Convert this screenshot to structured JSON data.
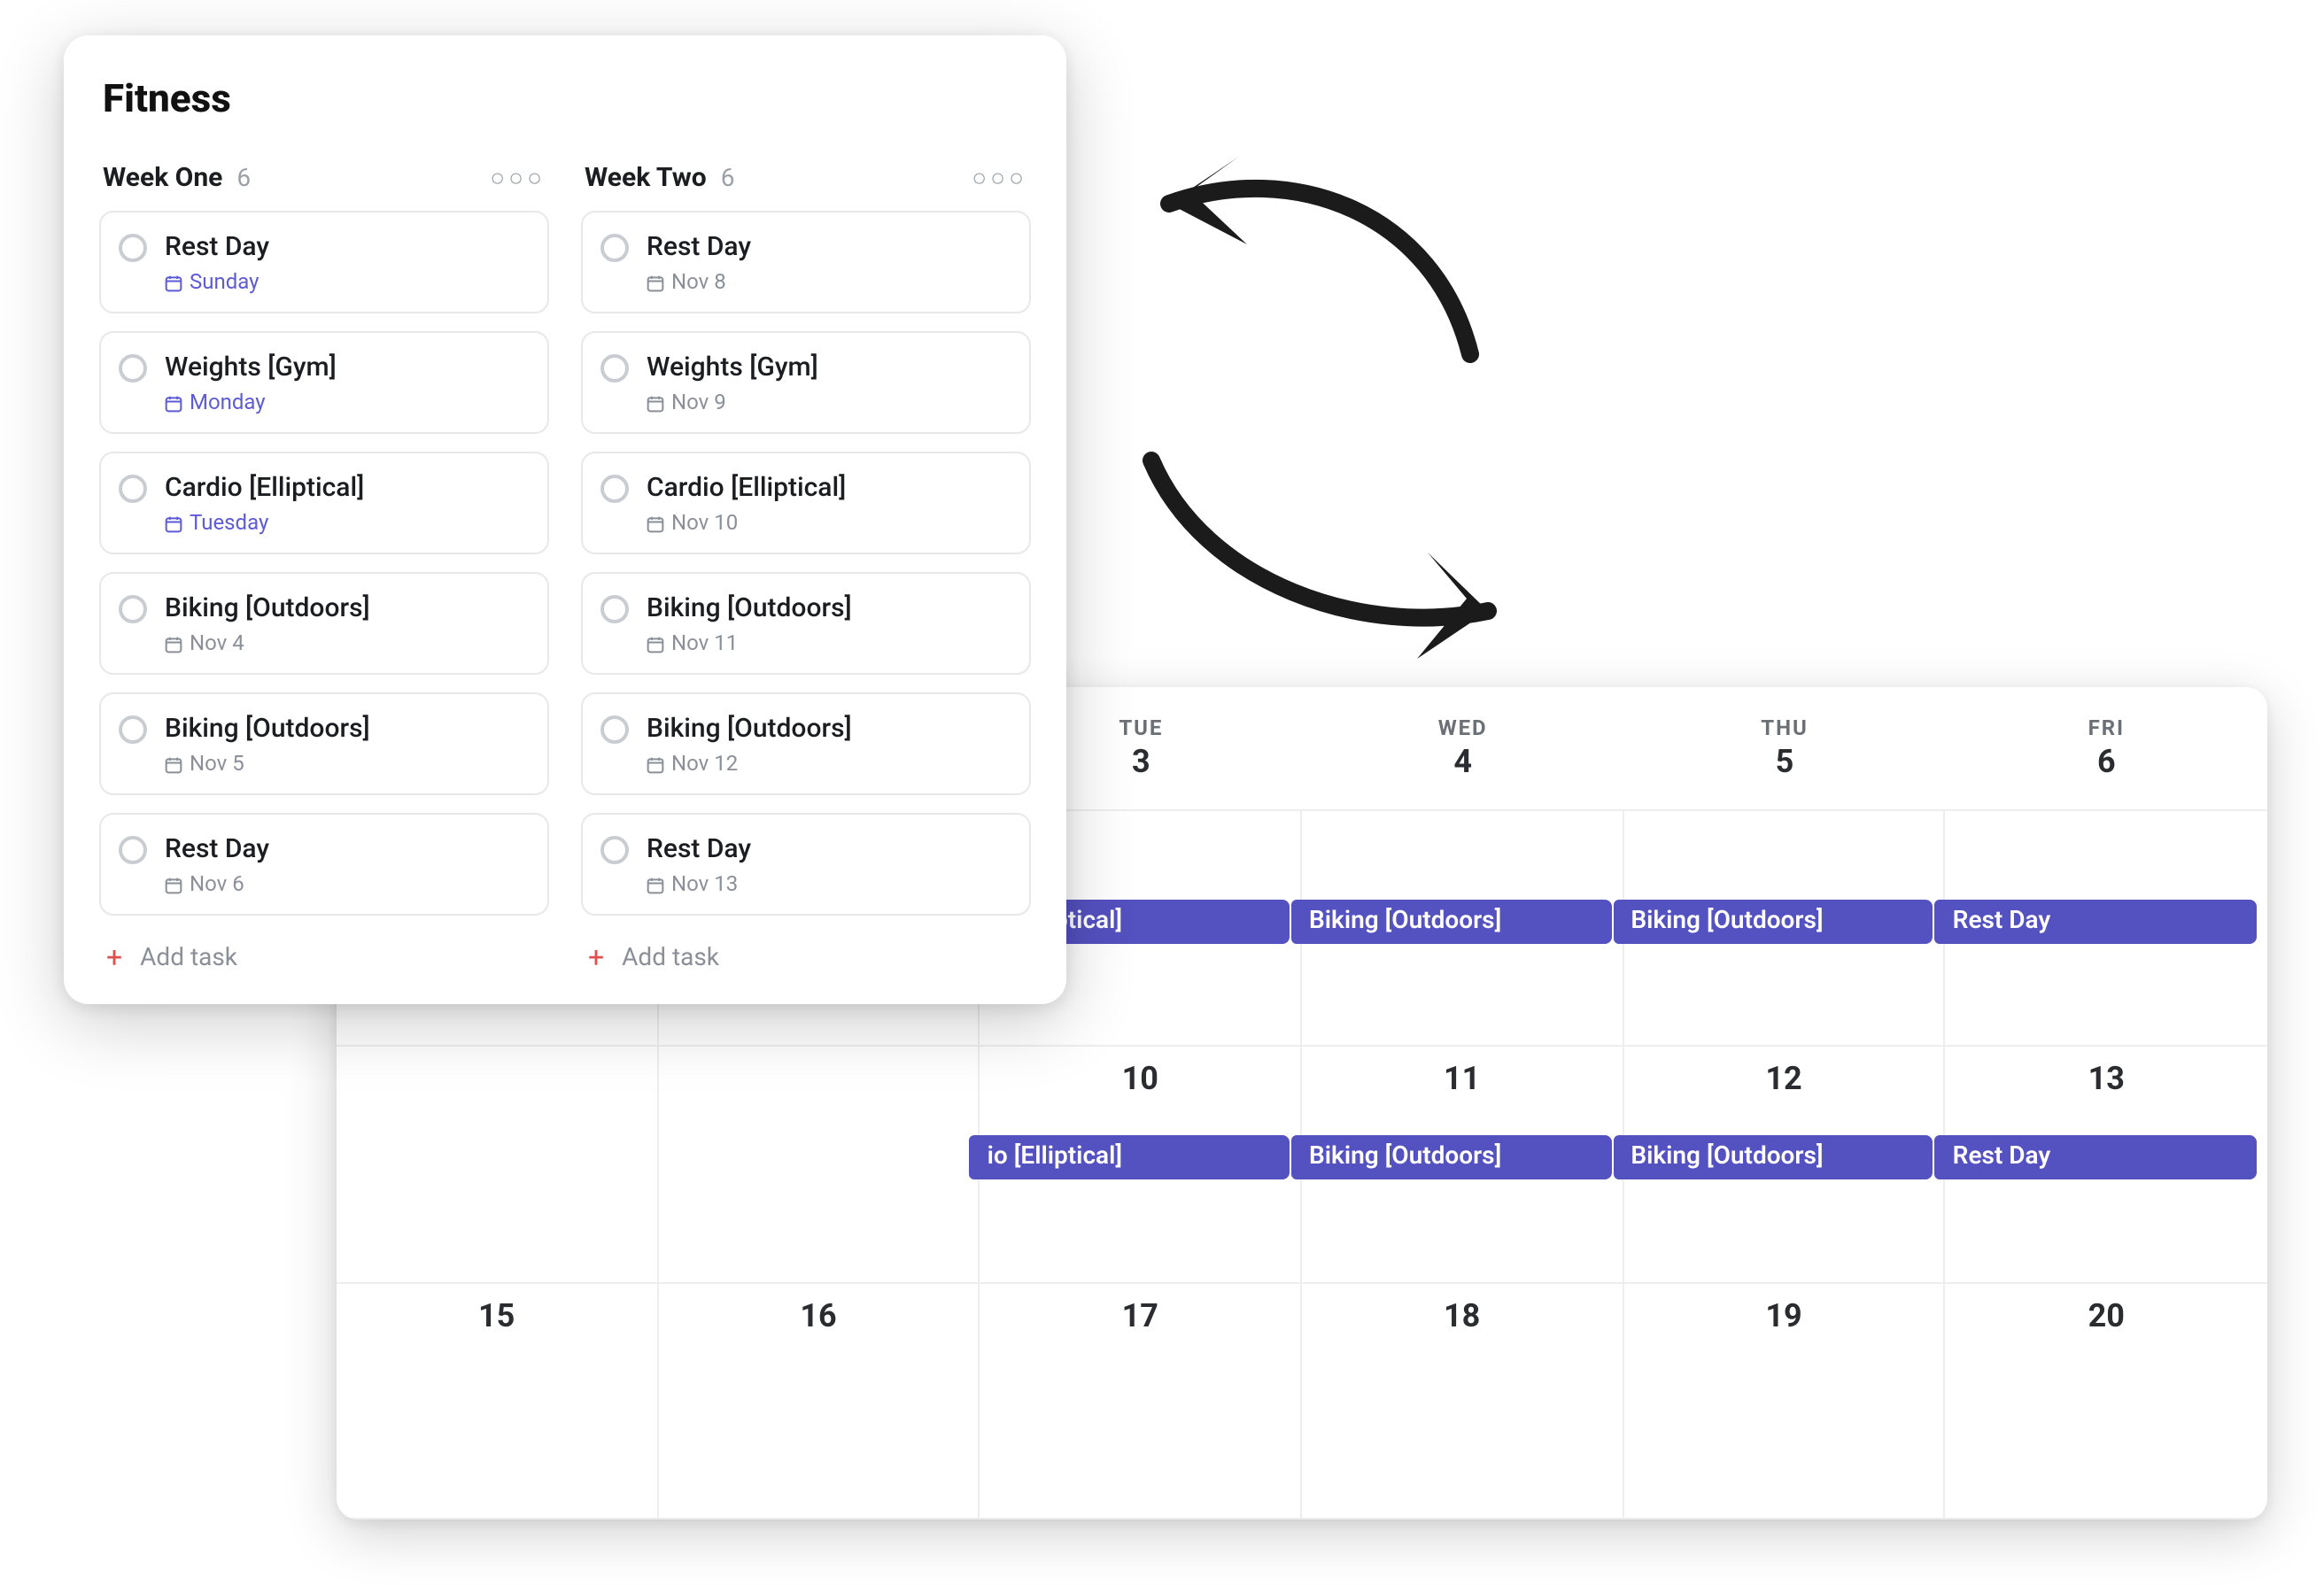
{
  "board": {
    "title": "Fitness",
    "add_task_label": "Add task",
    "columns": [
      {
        "name": "Week One",
        "count": "6",
        "tasks": [
          {
            "title": "Rest Day",
            "meta": "Sunday",
            "accent": true
          },
          {
            "title": "Weights [Gym]",
            "meta": "Monday",
            "accent": true
          },
          {
            "title": "Cardio [Elliptical]",
            "meta": "Tuesday",
            "accent": true
          },
          {
            "title": "Biking [Outdoors]",
            "meta": "Nov 4",
            "accent": false
          },
          {
            "title": "Biking [Outdoors]",
            "meta": "Nov 5",
            "accent": false
          },
          {
            "title": "Rest Day",
            "meta": "Nov 6",
            "accent": false
          }
        ]
      },
      {
        "name": "Week Two",
        "count": "6",
        "tasks": [
          {
            "title": "Rest Day",
            "meta": "Nov 8",
            "accent": false
          },
          {
            "title": "Weights [Gym]",
            "meta": "Nov 9",
            "accent": false
          },
          {
            "title": "Cardio [Elliptical]",
            "meta": "Nov 10",
            "accent": false
          },
          {
            "title": "Biking [Outdoors]",
            "meta": "Nov 11",
            "accent": false
          },
          {
            "title": "Biking [Outdoors]",
            "meta": "Nov 12",
            "accent": false
          },
          {
            "title": "Rest Day",
            "meta": "Nov 13",
            "accent": false
          }
        ]
      }
    ]
  },
  "calendar": {
    "days_of_week": [
      "TUE",
      "WED",
      "THU",
      "FRI"
    ],
    "header_dates": [
      "3",
      "4",
      "5",
      "6"
    ],
    "rows": [
      {
        "dates": [
          "3",
          "4",
          "5",
          "6"
        ],
        "events": [
          "io [Elliptical]",
          "Biking [Outdoors]",
          "Biking [Outdoors]",
          "Rest Day"
        ]
      },
      {
        "dates": [
          "10",
          "11",
          "12",
          "13"
        ],
        "events": [
          "io [Elliptical]",
          "Biking [Outdoors]",
          "Biking [Outdoors]",
          "Rest Day"
        ]
      },
      {
        "dates": [
          "15",
          "16",
          "17",
          "18",
          "19",
          "20"
        ],
        "events": []
      }
    ]
  },
  "colors": {
    "event": "#5451c0",
    "accent": "#5d5bd6",
    "muted": "#8a8f98"
  }
}
